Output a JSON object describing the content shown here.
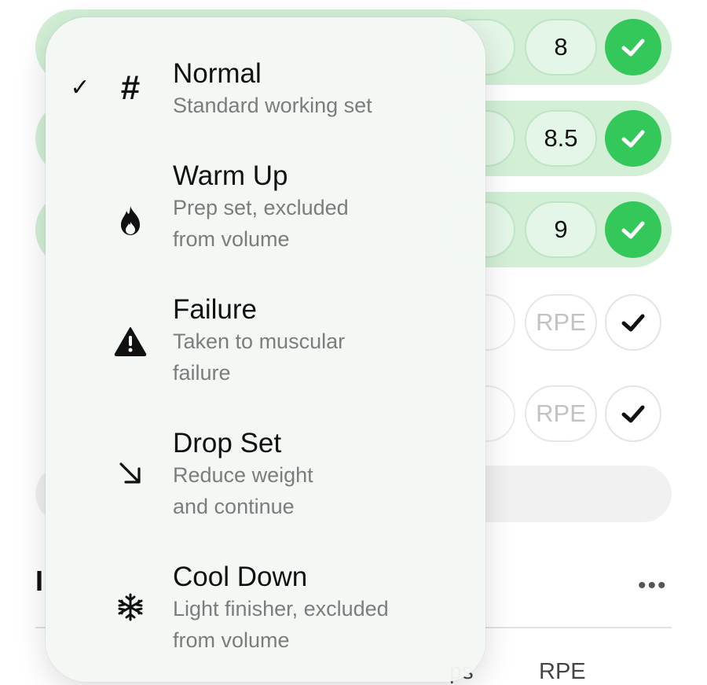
{
  "sets": [
    {
      "rpe": "8",
      "completed": true
    },
    {
      "rpe": "8.5",
      "completed": true
    },
    {
      "rpe": "9",
      "completed": true
    },
    {
      "rpe": "RPE",
      "completed": false
    },
    {
      "rpe": "RPE",
      "completed": false
    }
  ],
  "exercise": {
    "initial": "I",
    "more": "•••"
  },
  "columns": {
    "reps": "ps",
    "rpe": "RPE"
  },
  "set_type_menu": {
    "items": [
      {
        "icon": "hash-icon",
        "title": "Normal",
        "subtitle": [
          "Standard working set"
        ],
        "selected": true
      },
      {
        "icon": "flame-icon",
        "title": "Warm Up",
        "subtitle": [
          "Prep set, excluded",
          "from volume"
        ],
        "selected": false
      },
      {
        "icon": "warning-icon",
        "title": "Failure",
        "subtitle": [
          "Taken to muscular",
          "failure"
        ],
        "selected": false
      },
      {
        "icon": "arrow-down-right-icon",
        "title": "Drop Set",
        "subtitle": [
          "Reduce weight",
          "and continue"
        ],
        "selected": false
      },
      {
        "icon": "snowflake-icon",
        "title": "Cool Down",
        "subtitle": [
          "Light finisher, excluded",
          "from volume"
        ],
        "selected": false
      }
    ],
    "check_glyph": "✓"
  },
  "colors": {
    "done_row": "#d3f0d7",
    "check_on": "#34c759",
    "menu_bg": "#f4f8f5"
  }
}
